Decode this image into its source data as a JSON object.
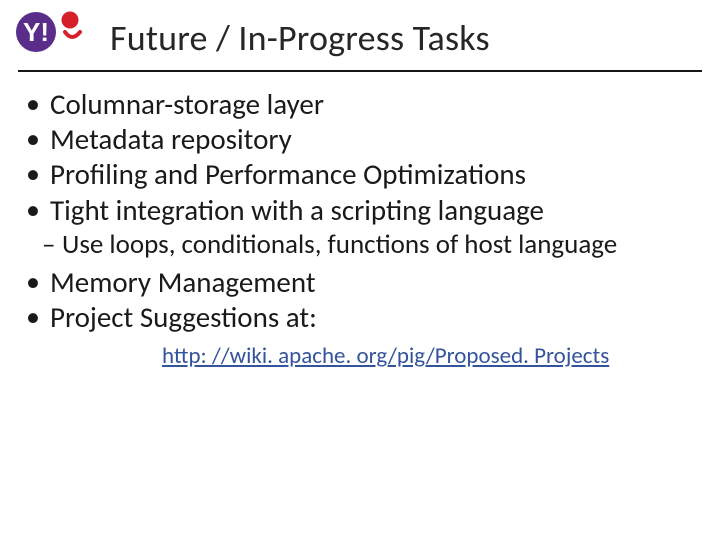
{
  "header": {
    "title": "Future / In-Progress Tasks",
    "logo_alt": "Yahoo! logo"
  },
  "bullets": {
    "b1": "Columnar-storage layer",
    "b2": "Metadata repository",
    "b3": "Profiling and Performance Optimizations",
    "b4": "Tight integration with a scripting language",
    "b4_sub": "Use loops, conditionals, functions of host language",
    "b5": "Memory Management",
    "b6": "Project Suggestions at:"
  },
  "link": {
    "text": "http: //wiki. apache. org/pig/Proposed. Projects",
    "href": "http://wiki.apache.org/pig/ProposedProjects"
  },
  "colors": {
    "link": "#33539c",
    "logo_purple": "#5a2d8a",
    "logo_red": "#d5202a"
  }
}
